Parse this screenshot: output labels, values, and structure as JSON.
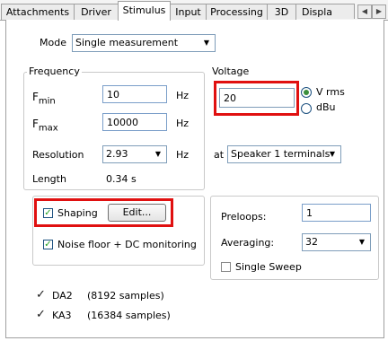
{
  "tabs": [
    "Attachments",
    "Driver",
    "Stimulus",
    "Input",
    "Processing",
    "3D",
    "Displa"
  ],
  "tab_scroll": {
    "left": "◀",
    "right": "▶"
  },
  "mode": {
    "label": "Mode",
    "value": "Single measurement"
  },
  "frequency": {
    "title": "Frequency",
    "fmin_label": "F",
    "fmin_sub": "min",
    "fmin_value": "10",
    "fmin_unit": "Hz",
    "fmax_label": "F",
    "fmax_sub": "max",
    "fmax_value": "10000",
    "fmax_unit": "Hz",
    "resolution_label": "Resolution",
    "resolution_value": "2.93",
    "resolution_unit": "Hz",
    "length_label": "Length",
    "length_value": "0.34 s"
  },
  "voltage": {
    "title": "Voltage",
    "value": "20",
    "radio_vrms": "V rms",
    "radio_dbu": "dBu",
    "at_label": "at",
    "at_value": "Speaker 1 terminals"
  },
  "shaping": {
    "label": "Shaping",
    "edit_button": "Edit...",
    "checked": true
  },
  "noise_floor": {
    "label": "Noise floor + DC  monitoring",
    "checked": true
  },
  "preloops": {
    "label": "Preloops:",
    "value": "1"
  },
  "averaging": {
    "label": "Averaging:",
    "value": "32"
  },
  "single_sweep": {
    "label": "Single Sweep",
    "checked": false
  },
  "signals": [
    {
      "name": "DA2",
      "info": "(8192 samples)"
    },
    {
      "name": "KA3",
      "info": "(16384 samples)"
    }
  ],
  "colors": {
    "highlight": "#e01010",
    "check": "#21a121"
  }
}
